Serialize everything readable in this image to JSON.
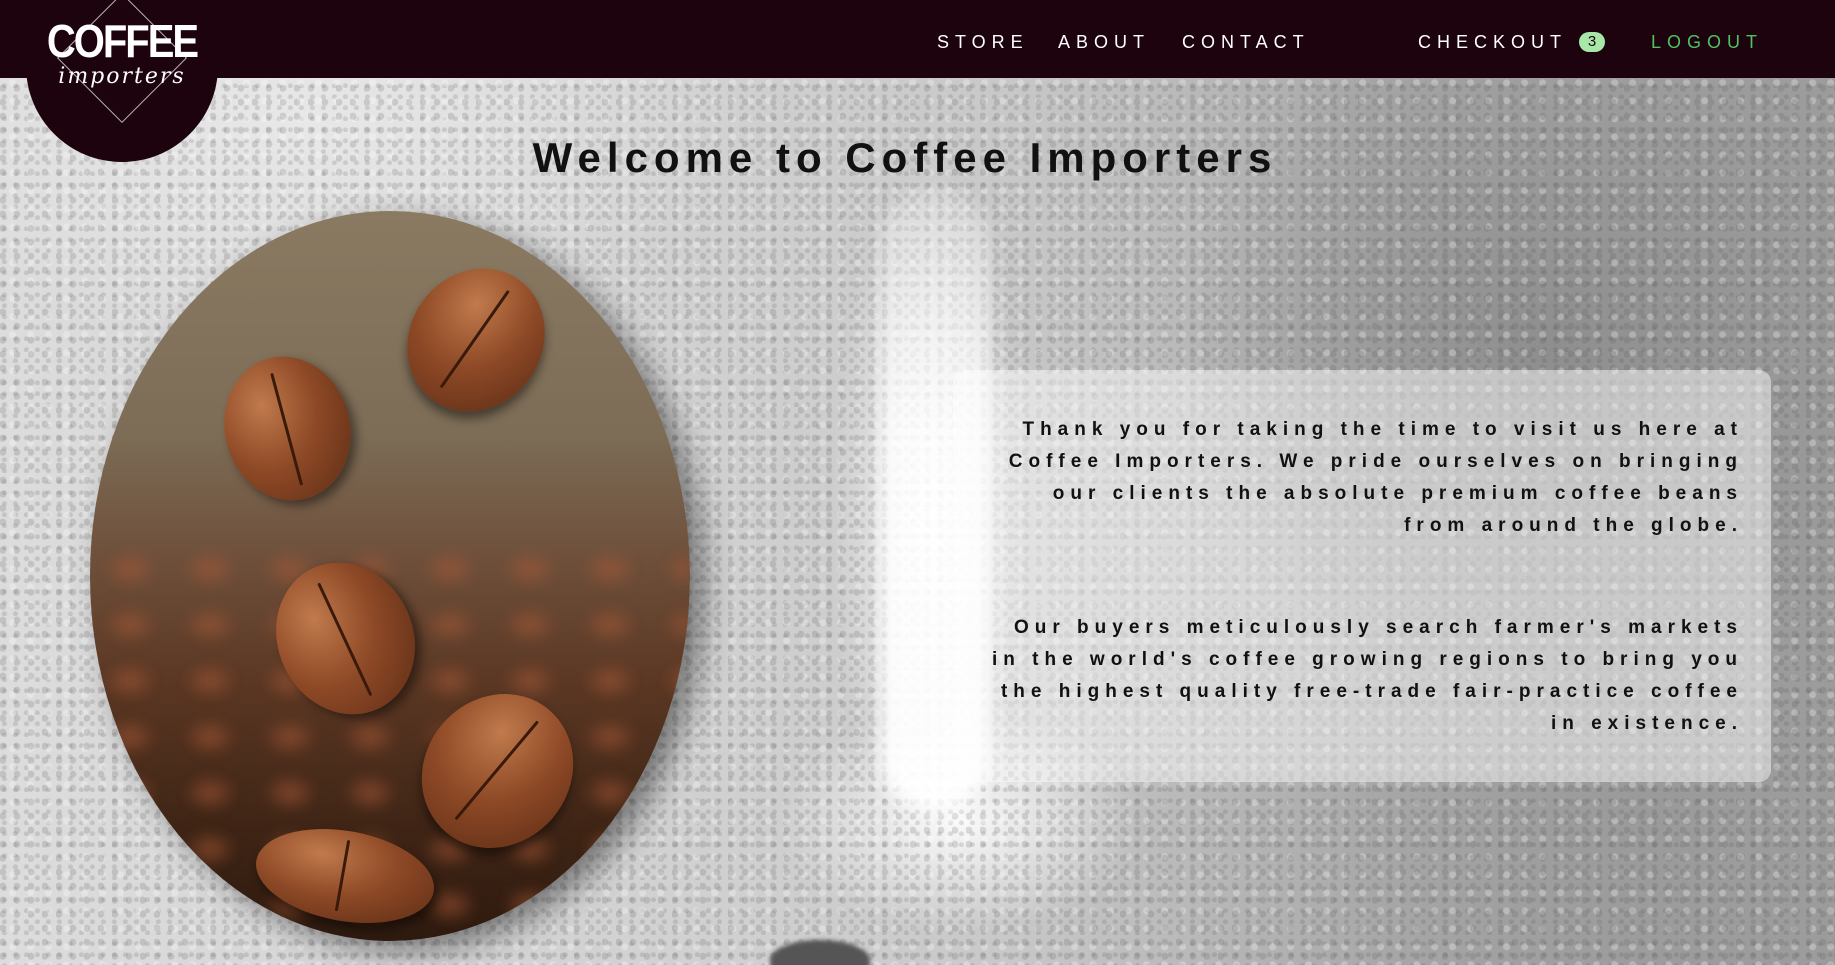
{
  "nav": {
    "logo_main": "COFFEE",
    "logo_sub": "importers",
    "store": "STORE",
    "about": "ABOUT",
    "contact": "CONTACT",
    "checkout": "CHECKOUT",
    "cart_count": "3",
    "logout": "LOGOUT"
  },
  "main": {
    "title": "Welcome to Coffee Importers",
    "paragraph_1": "Thank you for taking the time to visit us here at Coffee Importers. We pride ourselves on bringing our clients the absolute premium coffee beans from around the globe.",
    "paragraph_2": "Our buyers meticulously search farmer's markets in the world's coffee growing regions to bring you the highest quality free-trade fair-practice coffee in existence."
  },
  "colors": {
    "navbar": "#1d030e",
    "logout": "#4fc262",
    "badge": "#a7e7a8"
  }
}
